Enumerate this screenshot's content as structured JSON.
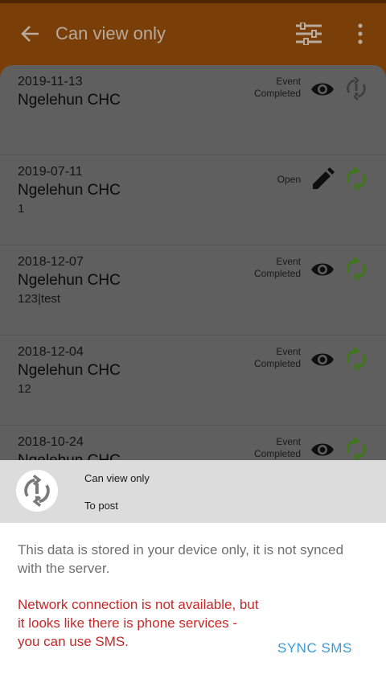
{
  "toolbar": {
    "title": "Can view only",
    "back_icon": "arrow-back-icon",
    "filter_icon": "filter-sliders-icon",
    "more_icon": "more-vertical-icon",
    "color": "#7a3f09"
  },
  "events": [
    {
      "date": "2019-11-13",
      "org_unit": "Ngelehun CHC",
      "value": "",
      "status_line1": "Event",
      "status_line2": "Completed",
      "action_icon": "eye-icon",
      "sync_icon": "sync-error-icon"
    },
    {
      "date": "2019-07-11",
      "org_unit": "Ngelehun CHC",
      "value": "1",
      "status_line1": "Open",
      "status_line2": "",
      "action_icon": "edit-pencil-icon",
      "sync_icon": "sync-icon"
    },
    {
      "date": "2018-12-07",
      "org_unit": "Ngelehun CHC",
      "value": "123|test",
      "status_line1": "Event",
      "status_line2": "Completed",
      "action_icon": "eye-icon",
      "sync_icon": "sync-icon"
    },
    {
      "date": "2018-12-04",
      "org_unit": "Ngelehun CHC",
      "value": "12",
      "status_line1": "Event",
      "status_line2": "Completed",
      "action_icon": "eye-icon",
      "sync_icon": "sync-icon"
    },
    {
      "date": "2018-10-24",
      "org_unit": "Ngelehun CHC",
      "value": "",
      "status_line1": "Event",
      "status_line2": "Completed",
      "action_icon": "eye-icon",
      "sync_icon": "sync-icon"
    }
  ],
  "sheet": {
    "title": "Can view only",
    "subtitle": "To post",
    "icon": "sync-error-icon",
    "info": "This data is stored in your device only, it is not synced with the server.",
    "warning": "Network connection is not available, but it looks like there is phone services - you can use SMS.",
    "sms_button": "SYNC SMS"
  },
  "colors": {
    "sync_green": "#3b7a14",
    "warning_red": "#c62828",
    "link_blue": "#3a9ad6"
  }
}
